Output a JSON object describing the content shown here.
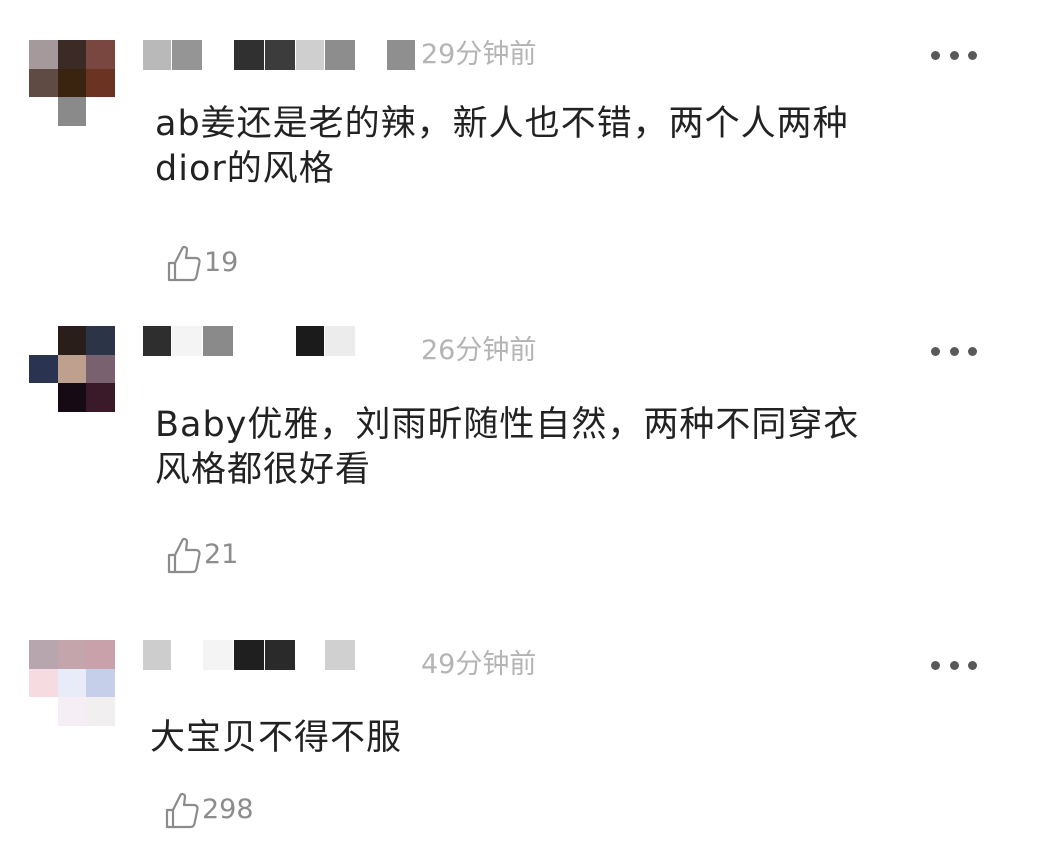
{
  "comments": [
    {
      "time": "29分钟前",
      "text_lines": [
        "ab姜还是老的辣，新人也不错，两个人两种",
        "dior的风格"
      ],
      "likes": "19",
      "avatar_colors": [
        "#a6999b",
        "#3b2a25",
        "#7a4640",
        "#5f4a44",
        "#3a2410",
        "#6b3422",
        "#ffffff",
        "#8a8a8a",
        "#ffffff"
      ],
      "name_mosaic_colors": [
        "#b9b9b9",
        "#959595",
        "#ffffff",
        "#303030",
        "#3c3c3c",
        "#cfcfcf",
        "#8d8d8d",
        "#ffffff",
        "#8f8f8f"
      ]
    },
    {
      "time": "26分钟前",
      "text_lines": [
        "Baby优雅，刘雨昕随性自然，两种不同穿衣",
        "风格都很好看"
      ],
      "likes": "21",
      "avatar_colors": [
        "#ffffff",
        "#2a1e1a",
        "#2c3548",
        "#2a3350",
        "#bea08e",
        "#7a6170",
        "#ffffff",
        "#160a14",
        "#3a1a28"
      ],
      "name_mosaic_colors": [
        "#2e2e2e",
        "#f4f4f4",
        "#8a8a8a",
        "#ffffff",
        "#ffffff",
        "#1b1b1b",
        "#ececec"
      ]
    },
    {
      "time": "49分钟前",
      "text_lines": [
        "大宝贝不得不服"
      ],
      "likes": "298",
      "avatar_colors": [
        "#b7a6ad",
        "#c4a5ab",
        "#c9a1aa",
        "#f6dce0",
        "#e8ecf8",
        "#c5cfe9",
        "#ffffff",
        "#f6eef5",
        "#f1efef"
      ],
      "name_mosaic_colors": [
        "#cdcdcd",
        "#ffffff",
        "#f4f4f4",
        "#1f1f1f",
        "#2a2a2a",
        "#ffffff",
        "#d0d0d0"
      ]
    }
  ],
  "icons": {
    "like": "thumbs-up-outline-icon",
    "more": "more-dots-icon"
  }
}
